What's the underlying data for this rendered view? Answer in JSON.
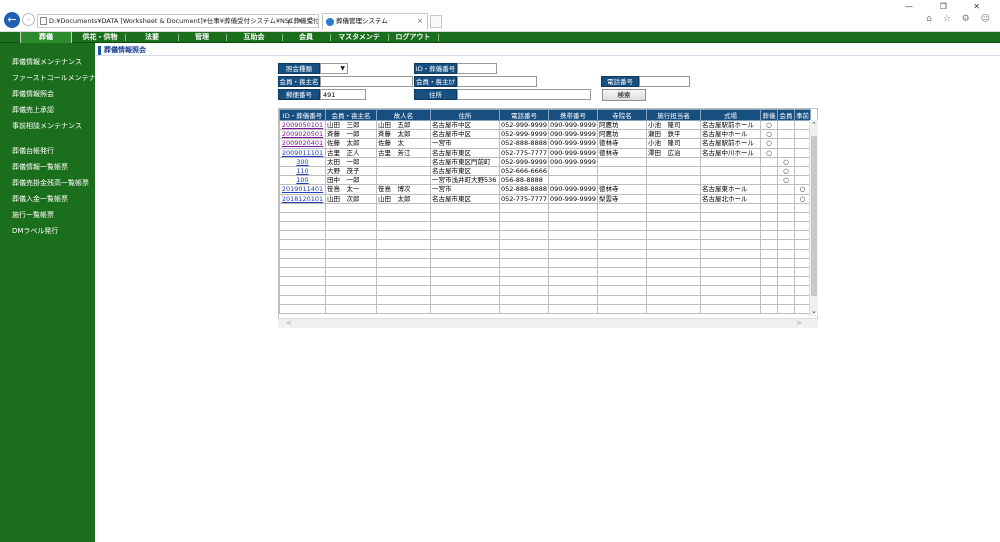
{
  "browser": {
    "address": "D:¥Documents¥DATA [Worksheet & Document]¥仕事¥葬儀受付システム¥NSC葬儀受付シス",
    "address_tools": "ρ ▾ C",
    "tab_title": "葬儀管理システム",
    "tab_close": "×",
    "back_glyph": "←",
    "forward_glyph": "›",
    "window_controls": "— ❐ ✕",
    "right_icons": "⌂ ☆ ⚙ ☺"
  },
  "menu": {
    "items": [
      "葬儀",
      "供花・供物",
      "法要",
      "管理",
      "互助会",
      "会員",
      "マスタメンテ",
      "ログアウト"
    ],
    "active": "葬儀"
  },
  "sidebar": {
    "items": [
      "葬儀情報メンテナンス",
      "ファーストコールメンテナンス",
      "葬儀情報照会",
      "葬儀売上承認",
      "事前相談メンテナンス",
      "葬儀台帳発行",
      "葬儀情報一覧帳票",
      "葬儀売掛金残高一覧帳票",
      "葬儀入金一覧帳票",
      "施行一覧帳票",
      "DMラベル発行"
    ]
  },
  "page": {
    "title": "葬儀情報照会"
  },
  "form": {
    "label_kind": "照会種類",
    "kind_value": "",
    "label_id": "ID・葬儀番号",
    "id_value": "",
    "label_member_name": "会員・喪主名",
    "member_name_value": "",
    "label_member_kana": "会員・喪主ｶﾅ",
    "member_kana_value": "",
    "label_phone": "電話番号",
    "phone_value": "",
    "label_postal": "郵便番号",
    "postal_value": "491",
    "label_address": "住所",
    "address_value": "",
    "search_button": "検索"
  },
  "table": {
    "headers": [
      "ID・葬儀番号",
      "会員・喪主名",
      "故人名",
      "住所",
      "電話番号",
      "携帯番号",
      "寺院名",
      "施行担当者",
      "式場",
      "葬儀",
      "会員",
      "事前"
    ],
    "rows": [
      [
        "2009050101",
        "山田　三郎",
        "山田　五郎",
        "名古屋市中区",
        "052-999-9999",
        "090-999-9999",
        "阿鷹坊",
        "小池　隆司",
        "名古屋駅前ホール",
        "○",
        "",
        ""
      ],
      [
        "2009020501",
        "斉藤　一郎",
        "斉藤　太郎",
        "名古屋市中区",
        "052-999-9999",
        "090-999-9999",
        "阿鷹坊",
        "瀬田　鉄平",
        "名古屋中ホール",
        "○",
        "",
        ""
      ],
      [
        "2009020401",
        "佐藤　太郎",
        "佐藤　太",
        "一宮市",
        "052-888-8888",
        "090-999-9999",
        "徳林寺",
        "小池　隆司",
        "名古屋駅前ホール",
        "○",
        "",
        ""
      ],
      [
        "2009011101",
        "古里　正人",
        "古里　芳江",
        "名古屋市東区",
        "052-775-7777",
        "090-999-9999",
        "徳林寺",
        "澤田　広治",
        "名古屋中川ホール",
        "○",
        "",
        ""
      ],
      [
        "300",
        "太田　一郎",
        "",
        "名古屋市東区門前町",
        "052-999-9999",
        "090-999-9999",
        "",
        "",
        "",
        "",
        "○",
        ""
      ],
      [
        "110",
        "大野　茂子",
        "",
        "名古屋市東区",
        "052-666-6666",
        "",
        "",
        "",
        "",
        "",
        "○",
        ""
      ],
      [
        "100",
        "田中　一郎",
        "",
        "一宮市浅井町大野536",
        "056-88-8888",
        "",
        "",
        "",
        "",
        "",
        "○",
        ""
      ],
      [
        "2019011401",
        "笹島　太一",
        "笹島　博次",
        "一宮市",
        "052-888-8888",
        "090-999-9999",
        "徳林寺",
        "",
        "名古屋東ホール",
        "",
        "",
        "○"
      ],
      [
        "2018120101",
        "山田　次郎",
        "山田　太郎",
        "名古屋市東区",
        "052-775-7777",
        "090-999-9999",
        "梨雲寺",
        "",
        "名古屋北ホール",
        "",
        "",
        "○"
      ]
    ],
    "visited_rows": [
      0,
      1,
      2
    ],
    "empty_rows": 12
  },
  "scroll": {
    "up": "⌃",
    "down": "⌄",
    "left": "<",
    "right": ">"
  }
}
